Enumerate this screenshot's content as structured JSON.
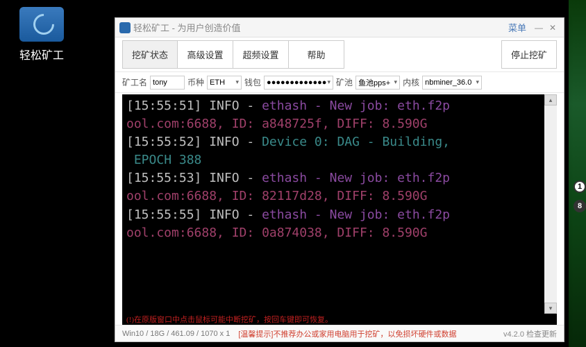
{
  "desktop_icon_label": "轻松矿工",
  "window": {
    "title": "轻松矿工 - 为用户创造价值",
    "menu_label": "菜单"
  },
  "tabs": {
    "mining_status": "挖矿状态",
    "advanced": "高级设置",
    "overclock": "超频设置",
    "help": "帮助",
    "stop": "停止挖矿"
  },
  "config": {
    "worker_label": "矿工名",
    "worker_value": "tony",
    "coin_label": "币种",
    "coin_value": "ETH",
    "wallet_label": "钱包",
    "wallet_value": "●●●●●●●●●●●●●",
    "pool_label": "矿池",
    "pool_value": "鱼池pps+",
    "core_label": "内核",
    "core_value": "nbminer_36.0"
  },
  "console_lines": [
    {
      "ts": "[15:55:51]",
      "info": " INFO - ",
      "rest": [
        {
          "cls": "eth",
          "t": "ethash - New job: eth.f2p"
        }
      ]
    },
    {
      "pool": "ool.com:6688, ID: a848725f, DIFF: 8.590G"
    },
    {
      "ts": "[15:55:52]",
      "info": " INFO - ",
      "rest": [
        {
          "cls": "dev",
          "t": "Device 0: DAG - Building,"
        }
      ]
    },
    {
      "dev": " EPOCH 388"
    },
    {
      "ts": "[15:55:53]",
      "info": " INFO - ",
      "rest": [
        {
          "cls": "eth",
          "t": "ethash - New job: eth.f2p"
        }
      ]
    },
    {
      "pool": "ool.com:6688, ID: 82117d28, DIFF: 8.590G"
    },
    {
      "ts": "[15:55:55]",
      "info": " INFO - ",
      "rest": [
        {
          "cls": "eth",
          "t": "ethash - New job: eth.f2p"
        }
      ]
    },
    {
      "pool": "ool.com:6688, ID: 0a874038, DIFF: 8.590G"
    }
  ],
  "console_warning": "(!)在原版窗口中点击鼠标可能中断挖矿，按回车键即可恢复。",
  "status": {
    "sys": "Win10 / 18G / 461.09 / 1070 x 1",
    "tip": "[温馨提示]不推荐办公或家用电脑用于挖矿，以免损坏硬件或数据",
    "version": "v4.2.0 检查更新"
  }
}
